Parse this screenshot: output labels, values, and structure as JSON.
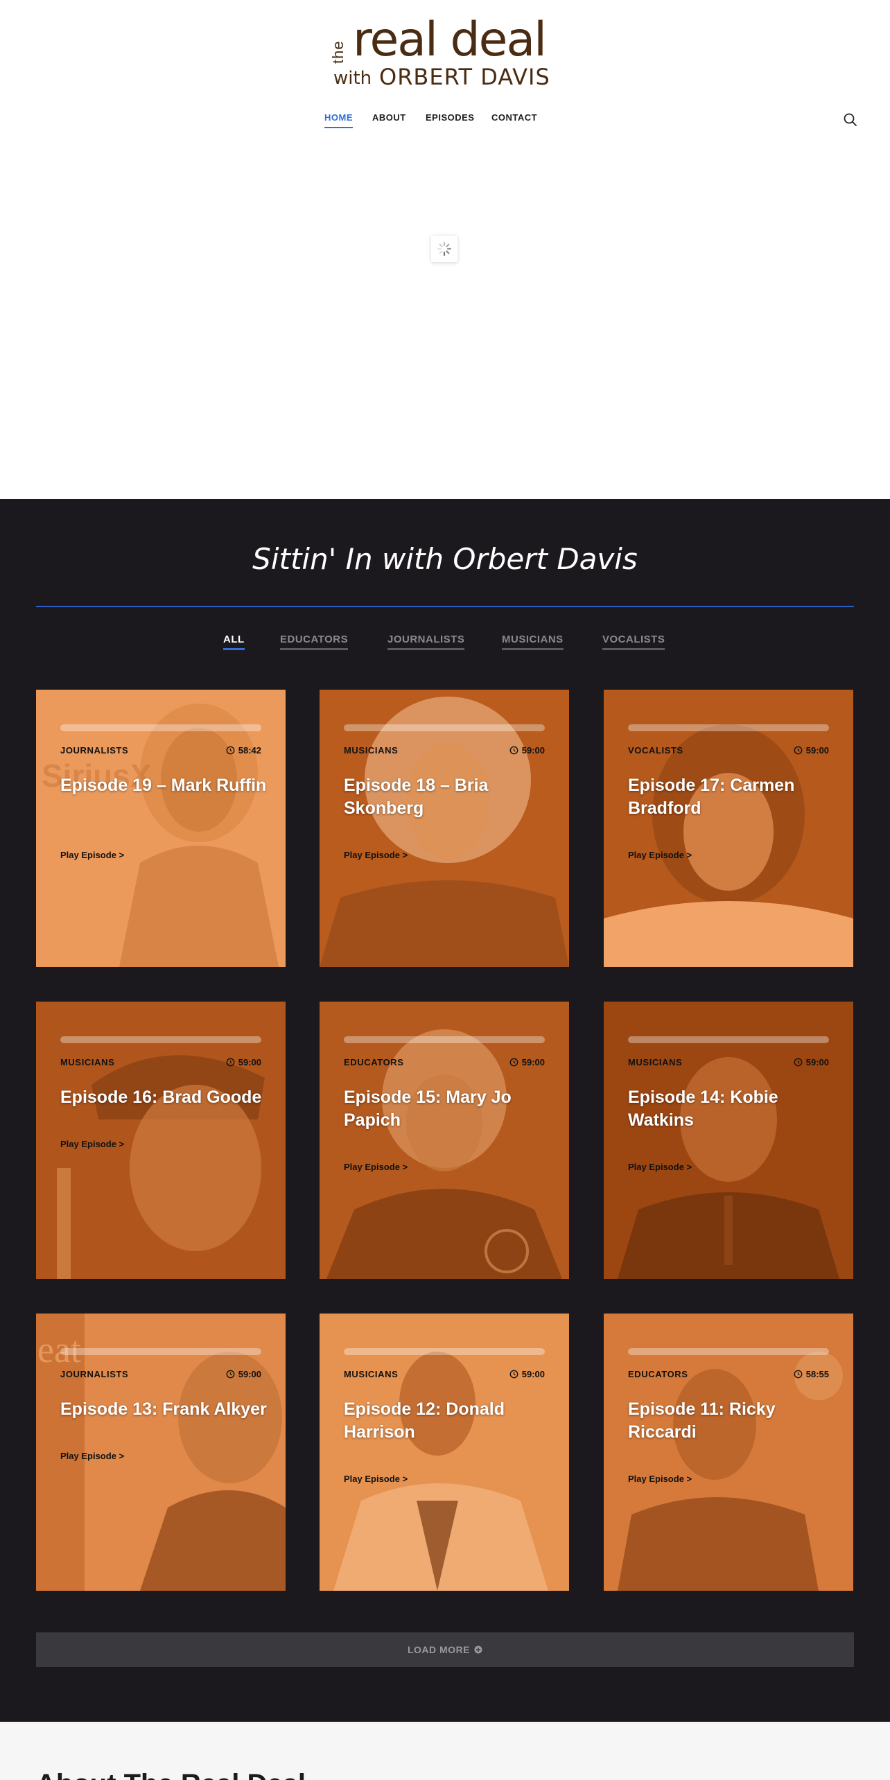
{
  "logo": {
    "the": "the",
    "realdeal": "real deal",
    "with": "with",
    "name": "ORBERT DAVIS"
  },
  "nav": {
    "items": [
      "HOME",
      "ABOUT",
      "EPISODES",
      "CONTACT"
    ],
    "active": "HOME"
  },
  "section": {
    "title": "Sittin' In with Orbert Davis",
    "filters": [
      "ALL",
      "EDUCATORS",
      "JOURNALISTS",
      "MUSICIANS",
      "VOCALISTS"
    ],
    "active_filter": "ALL"
  },
  "episodes": [
    {
      "category": "JOURNALISTS",
      "duration": "58:42",
      "title": "Episode 19 – Mark Ruffin",
      "play": "Play Episode >"
    },
    {
      "category": "MUSICIANS",
      "duration": "59:00",
      "title": "Episode 18 – Bria Skonberg",
      "play": "Play Episode >"
    },
    {
      "category": "VOCALISTS",
      "duration": "59:00",
      "title": "Episode 17: Carmen Bradford",
      "play": "Play Episode >"
    },
    {
      "category": "MUSICIANS",
      "duration": "59:00",
      "title": "Episode 16: Brad Goode",
      "play": "Play Episode >"
    },
    {
      "category": "EDUCATORS",
      "duration": "59:00",
      "title": "Episode 15: Mary Jo Papich",
      "play": "Play Episode >"
    },
    {
      "category": "MUSICIANS",
      "duration": "59:00",
      "title": "Episode 14: Kobie Watkins",
      "play": "Play Episode >"
    },
    {
      "category": "JOURNALISTS",
      "duration": "59:00",
      "title": "Episode 13: Frank Alkyer",
      "play": "Play Episode >"
    },
    {
      "category": "MUSICIANS",
      "duration": "59:00",
      "title": "Episode 12: Donald Harrison",
      "play": "Play Episode >"
    },
    {
      "category": "EDUCATORS",
      "duration": "58:55",
      "title": "Episode 11: Ricky Riccardi",
      "play": "Play Episode >"
    }
  ],
  "load_more": "LOAD MORE",
  "about": {
    "title": "About The Real Deal"
  },
  "colors": {
    "accent": "#2f6fd6",
    "dark_bg": "#1b191d",
    "brand_brown": "#4a2c12",
    "card_orange": "#e88a4a",
    "card_orange_dark": "#a64a12"
  },
  "icons": {
    "search": "search-icon",
    "clock": "clock-icon",
    "loader": "spinner-icon",
    "load_more": "plus-circle-icon"
  }
}
